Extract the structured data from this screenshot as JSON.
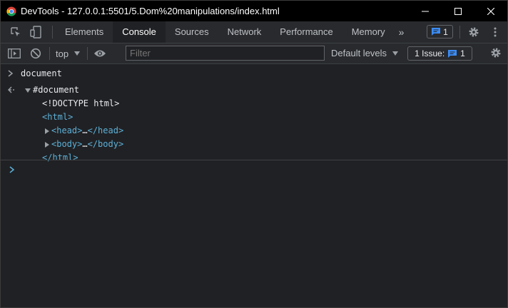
{
  "window": {
    "title": "DevTools - 127.0.0.1:5501/5.Dom%20manipulations/index.html"
  },
  "tabs": [
    {
      "label": "Elements",
      "active": false
    },
    {
      "label": "Console",
      "active": true
    },
    {
      "label": "Sources",
      "active": false
    },
    {
      "label": "Network",
      "active": false
    },
    {
      "label": "Performance",
      "active": false
    },
    {
      "label": "Memory",
      "active": false
    }
  ],
  "tabbar": {
    "more_symbol": "»",
    "message_count": "1"
  },
  "toolbar": {
    "context": "top",
    "filter_placeholder": "Filter",
    "levels_label": "Default levels",
    "issues_label": "1 Issue:",
    "issues_count": "1"
  },
  "console": {
    "input": "document",
    "result_label": "#document",
    "doctype": "<!DOCTYPE html>",
    "html_open": "<html>",
    "head_open": "<head>",
    "head_ellipsis": "…",
    "head_close": "</head>",
    "body_open": "<body>",
    "body_ellipsis": "…",
    "body_close": "</body>",
    "html_close": "</html>"
  },
  "colors": {
    "accent": "#5db0d7",
    "badge_blue": "#3b8cf5",
    "background": "#202124",
    "toolbar": "#292a2d"
  }
}
